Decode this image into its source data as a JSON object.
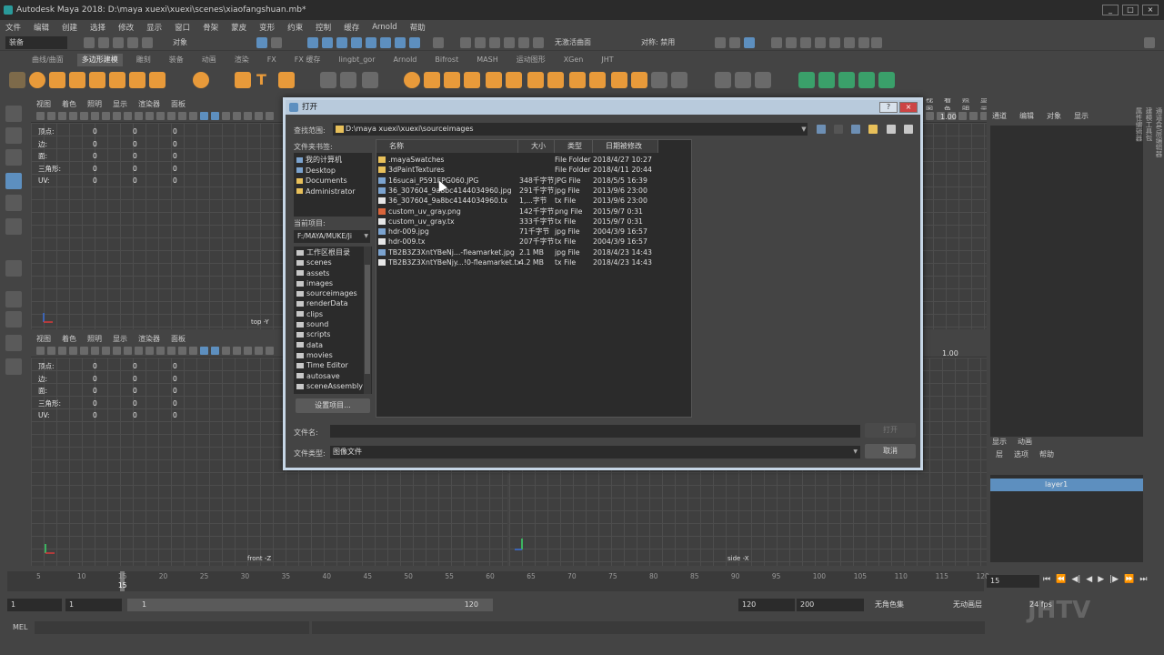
{
  "window": {
    "title": "Autodesk Maya 2018: D:\\maya xuexi\\xuexi\\scenes\\xiaofangshuan.mb*"
  },
  "menubar": [
    "文件",
    "编辑",
    "创建",
    "选择",
    "修改",
    "显示",
    "窗口",
    "骨架",
    "蒙皮",
    "变形",
    "约束",
    "控制",
    "缓存",
    "Arnold",
    "帮助"
  ],
  "statusline": {
    "mode": "装备",
    "object_label": "对象",
    "live_surface": "无激活曲面",
    "symmetry": "对称: 禁用"
  },
  "shelf_tabs": [
    "曲线/曲面",
    "多边形建模",
    "雕刻",
    "装备",
    "动画",
    "渲染",
    "FX",
    "FX 缓存",
    "lingbt_gor",
    "Arnold",
    "Bifrost",
    "MASH",
    "运动图形",
    "XGen",
    "JHT"
  ],
  "shelf_active_tab": "多边形建模",
  "viewport_menu": [
    "视图",
    "着色",
    "照明",
    "显示",
    "渲染器",
    "面板"
  ],
  "hud": [
    {
      "label": "顶点:",
      "v1": "0",
      "v2": "0",
      "v3": "0"
    },
    {
      "label": "边:",
      "v1": "0",
      "v2": "0",
      "v3": "0"
    },
    {
      "label": "面:",
      "v1": "0",
      "v2": "0",
      "v3": "0"
    },
    {
      "label": "三角形:",
      "v1": "0",
      "v2": "0",
      "v3": "0"
    },
    {
      "label": "UV:",
      "v1": "0",
      "v2": "0",
      "v3": "0"
    }
  ],
  "viewports": {
    "top_label": "top -Y",
    "front_label": "front -Z",
    "side_label": "side -X",
    "camera_value": "1.00"
  },
  "right_panel": {
    "menu": [
      "通道",
      "编辑",
      "对象",
      "显示"
    ],
    "tabs": [
      "显示",
      "动画"
    ],
    "layer_menu": [
      "层",
      "选项",
      "帮助"
    ],
    "layer_name": "layer1",
    "vertical_tabs": [
      "通道盒/层编辑器",
      "建模工具包",
      "属性编辑器"
    ]
  },
  "timeline": {
    "ticks": [
      "5",
      "10",
      "15",
      "20",
      "25",
      "30",
      "35",
      "40",
      "45",
      "50",
      "55",
      "60",
      "65",
      "70",
      "75",
      "80",
      "85",
      "90",
      "95",
      "100",
      "105",
      "110",
      "115",
      "120"
    ],
    "current": "15",
    "current_frame": "15"
  },
  "range": {
    "start": "1",
    "start2": "1",
    "slider_start": "1",
    "slider_end": "120",
    "end": "120",
    "end2": "200",
    "character_set": "无角色集",
    "anim_layer": "无动画层",
    "fps": "24 fps"
  },
  "cmdline": {
    "label": "MEL"
  },
  "watermark": "JHTV",
  "dialog": {
    "title": "打开",
    "look_in_label": "查找范围:",
    "look_in_path": "D:\\maya xuexi\\xuexi\\sourceimages",
    "bookmarks_label": "文件夹书签:",
    "bookmarks": [
      "我的计算机",
      "Desktop",
      "Documents",
      "Administrator"
    ],
    "project_label": "当前项目:",
    "project_path": "F:/MAYA/MUKE/Ji",
    "project_folders": [
      "工作区根目录",
      "scenes",
      "assets",
      "images",
      "sourceimages",
      "renderData",
      "clips",
      "sound",
      "scripts",
      "data",
      "movies",
      "Time Editor",
      "autosave",
      "sceneAssembly"
    ],
    "set_project_button": "设置项目...",
    "columns": [
      "名称",
      "大小",
      "类型",
      "日期被修改"
    ],
    "files": [
      {
        "name": ".mayaSwatches",
        "size": "",
        "type": "File Folder",
        "date": "2018/4/27 10:27",
        "icon": "folder"
      },
      {
        "name": "3dPaintTextures",
        "size": "",
        "type": "File Folder",
        "date": "2018/4/11 20:44",
        "icon": "folder"
      },
      {
        "name": "16sucai_P591FPG060.JPG",
        "size": "348千字节",
        "type": "JPG File",
        "date": "2018/5/5 16:39",
        "icon": "image"
      },
      {
        "name": "36_307604_9a8bc4144034960.jpg",
        "size": "291千字节",
        "type": "jpg File",
        "date": "2013/9/6 23:00",
        "icon": "image"
      },
      {
        "name": "36_307604_9a8bc4144034960.tx",
        "size": "1,...字节",
        "type": "tx File",
        "date": "2013/9/6 23:00",
        "icon": "file"
      },
      {
        "name": "custom_uv_gray.png",
        "size": "142千字节",
        "type": "png File",
        "date": "2015/9/7 0:31",
        "icon": "png"
      },
      {
        "name": "custom_uv_gray.tx",
        "size": "333千字节",
        "type": "tx File",
        "date": "2015/9/7 0:31",
        "icon": "file"
      },
      {
        "name": "hdr-009.jpg",
        "size": "71千字节",
        "type": "jpg File",
        "date": "2004/3/9 16:57",
        "icon": "image"
      },
      {
        "name": "hdr-009.tx",
        "size": "207千字节",
        "type": "tx File",
        "date": "2004/3/9 16:57",
        "icon": "file"
      },
      {
        "name": "TB2B3Z3XntYBeNj...-fleamarket.jpg",
        "size": "2.1 MB",
        "type": "jpg File",
        "date": "2018/4/23 14:43",
        "icon": "image"
      },
      {
        "name": "TB2B3Z3XntYBeNjy...!0-fleamarket.tx",
        "size": "4.2 MB",
        "type": "tx File",
        "date": "2018/4/23 14:43",
        "icon": "file"
      }
    ],
    "filename_label": "文件名:",
    "filename_value": "",
    "open_button": "打开",
    "filetype_label": "文件类型:",
    "filetype_value": "图像文件",
    "cancel_button": "取消"
  }
}
